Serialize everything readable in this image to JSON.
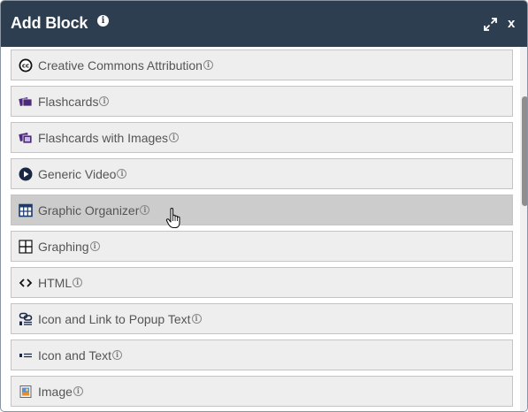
{
  "dialog": {
    "title": "Add Block",
    "info_glyph": "i",
    "close_label": "x",
    "icons": {
      "info": "info-icon",
      "expand": "expand-icon",
      "close": "close-icon"
    }
  },
  "blocks": [
    {
      "label": "Creative Commons Attribution",
      "icon": "creative-commons-icon"
    },
    {
      "label": "Flashcards",
      "icon": "flashcards-icon"
    },
    {
      "label": "Flashcards with Images",
      "icon": "flashcards-images-icon"
    },
    {
      "label": "Generic Video",
      "icon": "play-icon"
    },
    {
      "label": "Graphic Organizer",
      "icon": "table-icon"
    },
    {
      "label": "Graphing",
      "icon": "graph-axes-icon"
    },
    {
      "label": "HTML",
      "icon": "code-icon"
    },
    {
      "label": "Icon and Link to Popup Text",
      "icon": "link-icon"
    },
    {
      "label": "Icon and Text",
      "icon": "icon-text-icon"
    },
    {
      "label": "Image",
      "icon": "image-icon"
    }
  ],
  "selected_block": "Graphic Organizer",
  "colors": {
    "header": "#2c3e50",
    "item_bg": "#eeeeee",
    "item_selected": "#cccccc",
    "icon_purple": "#4b2a7b",
    "icon_dark": "#1a2744"
  }
}
